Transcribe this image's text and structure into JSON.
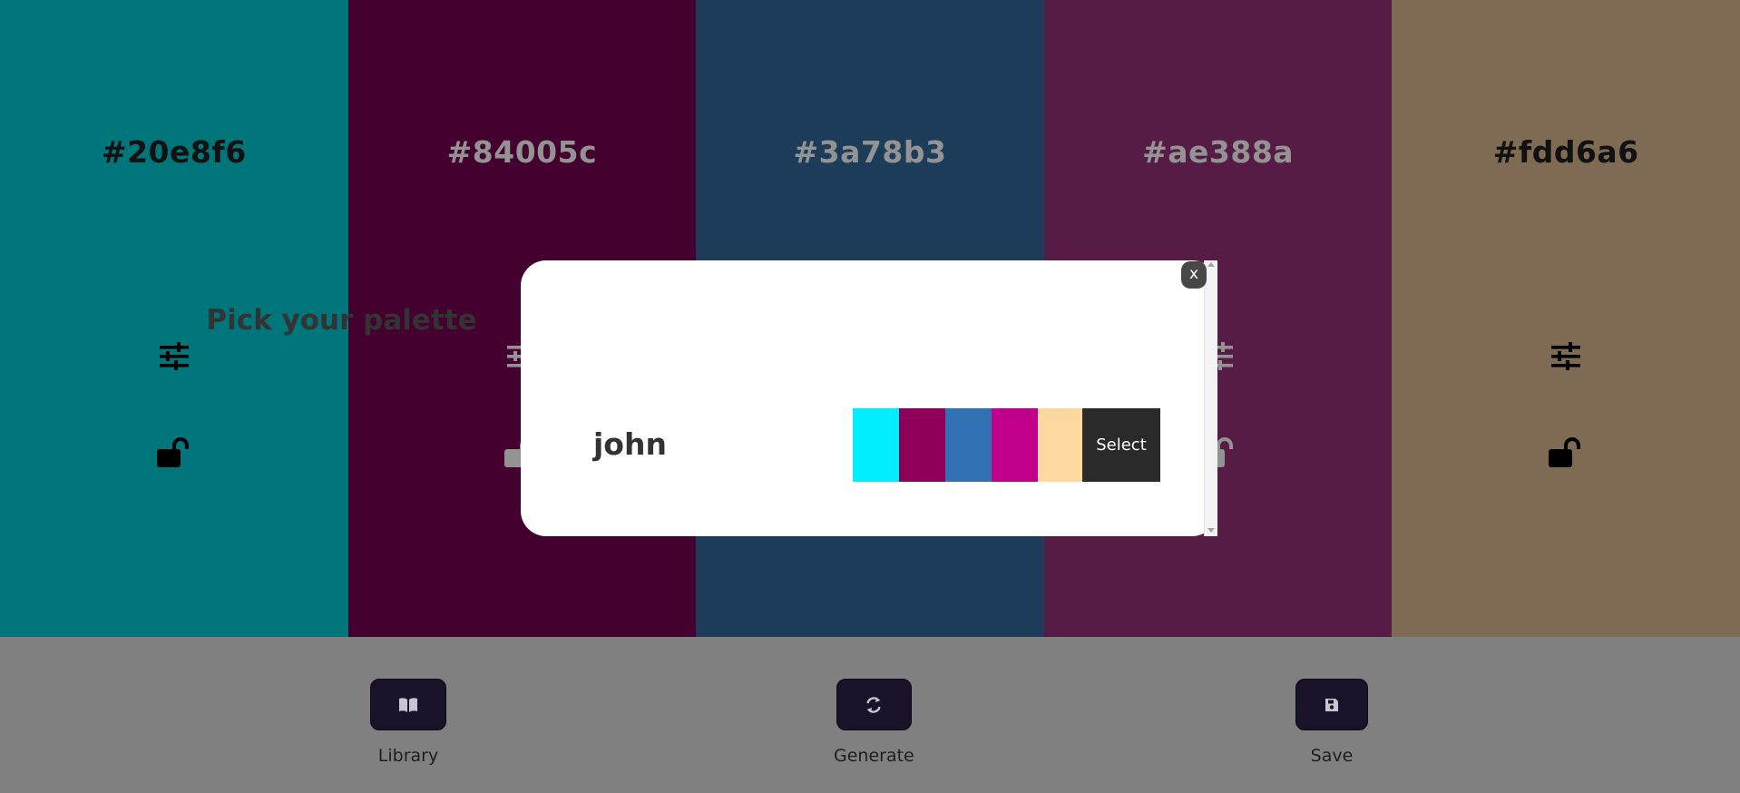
{
  "colors": [
    {
      "hex": "#20e8f6",
      "bg": "#00767b",
      "text_color": "#111111",
      "icon_color": "#000000",
      "adjust_icon": "sliders-icon",
      "lock_icon": "unlock-icon"
    },
    {
      "hex": "#84005c",
      "bg": "#44002e",
      "text_color": "#939393",
      "icon_color": "#939393",
      "adjust_icon": "sliders-icon",
      "lock_icon": "unlock-icon"
    },
    {
      "hex": "#3a78b3",
      "bg": "#1d3c5a",
      "text_color": "#939393",
      "icon_color": "#939393",
      "adjust_icon": "sliders-icon",
      "lock_icon": "unlock-icon"
    },
    {
      "hex": "#ae388a",
      "bg": "#571c45",
      "text_color": "#939393",
      "icon_color": "#939393",
      "adjust_icon": "sliders-icon",
      "lock_icon": "unlock-icon"
    },
    {
      "hex": "#fdd6a6",
      "bg": "#7f6b53",
      "text_color": "#111111",
      "icon_color": "#000000",
      "adjust_icon": "sliders-icon",
      "lock_icon": "unlock-icon"
    }
  ],
  "panel": {
    "library_label": "Library",
    "generate_label": "Generate",
    "save_label": "Save",
    "library_icon": "book-icon",
    "generate_icon": "refresh-icon",
    "save_icon": "save-icon"
  },
  "modal": {
    "title": "Pick your palette",
    "close_label": "x",
    "palettes": [
      {
        "name": "john",
        "colors": [
          "#00eeff",
          "#8f005a",
          "#3371b5",
          "#c0008a",
          "#ffd8a0"
        ],
        "select_label": "Select"
      }
    ]
  }
}
